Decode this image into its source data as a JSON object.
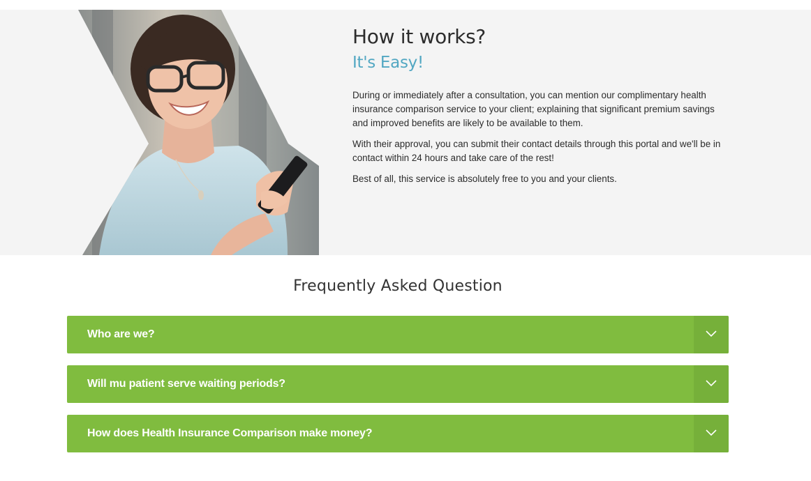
{
  "hero": {
    "title": "How it works?",
    "subtitle": "It's Easy!",
    "paragraphs": [
      "During or immediately after a consultation, you can mention our complimentary health insurance comparison service to your client; explaining that significant premium savings and improved benefits are likely to be available to them.",
      "With their approval, you can submit their contact details through this portal and we'll be in contact within 24 hours and take care of the rest!",
      "Best of all, this service is absolutely free to you and your clients."
    ]
  },
  "faq": {
    "title": "Frequently Asked Question",
    "items": [
      {
        "question": "Who are we?"
      },
      {
        "question": "Will mu patient serve waiting periods?"
      },
      {
        "question": "How does Health Insurance Comparison make money?"
      }
    ]
  },
  "colors": {
    "accent_blue": "#52a7c2",
    "faq_green": "#80bc3f",
    "faq_toggle_green": "#76b03a",
    "hero_background": "#f4f4f4"
  },
  "icons": {
    "faq_toggle": "chevron-down-icon",
    "hero_image": "woman-with-phone-photo"
  }
}
